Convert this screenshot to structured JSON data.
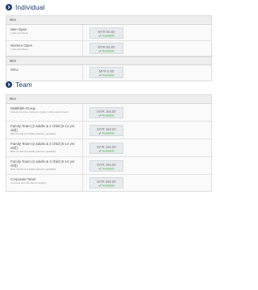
{
  "individual": {
    "heading": "Individual",
    "groups": [
      {
        "label": "5km",
        "items": [
          {
            "name": "Men Open",
            "sub": "1 lady and above",
            "price": "MYR 55.00",
            "status": "Available"
          },
          {
            "name": "Women Open",
            "sub": "1 lady and above",
            "price": "MYR 55.00",
            "status": "Available"
          }
        ]
      },
      {
        "label": "5km",
        "items": [
          {
            "name": "OKU",
            "sub": "",
            "price": "MYR 0.00",
            "status": "Available"
          }
        ]
      }
    ]
  },
  "team": {
    "heading": "Team",
    "groups": [
      {
        "label": "5km",
        "items": [
          {
            "name": "Multiblah Group",
            "sub": "Include 4 runners minimum (1 lady, 1 OKU and 1 Fresh)",
            "price": "MYR 165.00",
            "status": "Available"
          },
          {
            "name": "Family Team (2 adults & 1 child (5-14 yrs old))",
            "sub": "Must consist of 2 adults (parents / guardian)",
            "price": "MYR 165.00",
            "status": "Available"
          },
          {
            "name": "Family Team (2 adults & 2 child (5-14 yrs old))",
            "sub": "Must consist of 2 adults (parents / guardian)",
            "price": "MYR 165.00",
            "status": "Available"
          },
          {
            "name": "Family Team (2 adults & 3 child (5-14 yrs old))",
            "sub": "Must consist of 2 adults (parents / guardian)",
            "price": "MYR 165.00",
            "status": "Available"
          },
          {
            "name": "Corporate Team",
            "sub": "4 runners from the same company",
            "price": "MYR 265.00",
            "status": "Available"
          }
        ]
      }
    ]
  },
  "colors": {
    "accent": "#1a3a6b",
    "available": "#4caf50",
    "price_box": "#e8ebee",
    "group_bg": "#eeeeee"
  }
}
